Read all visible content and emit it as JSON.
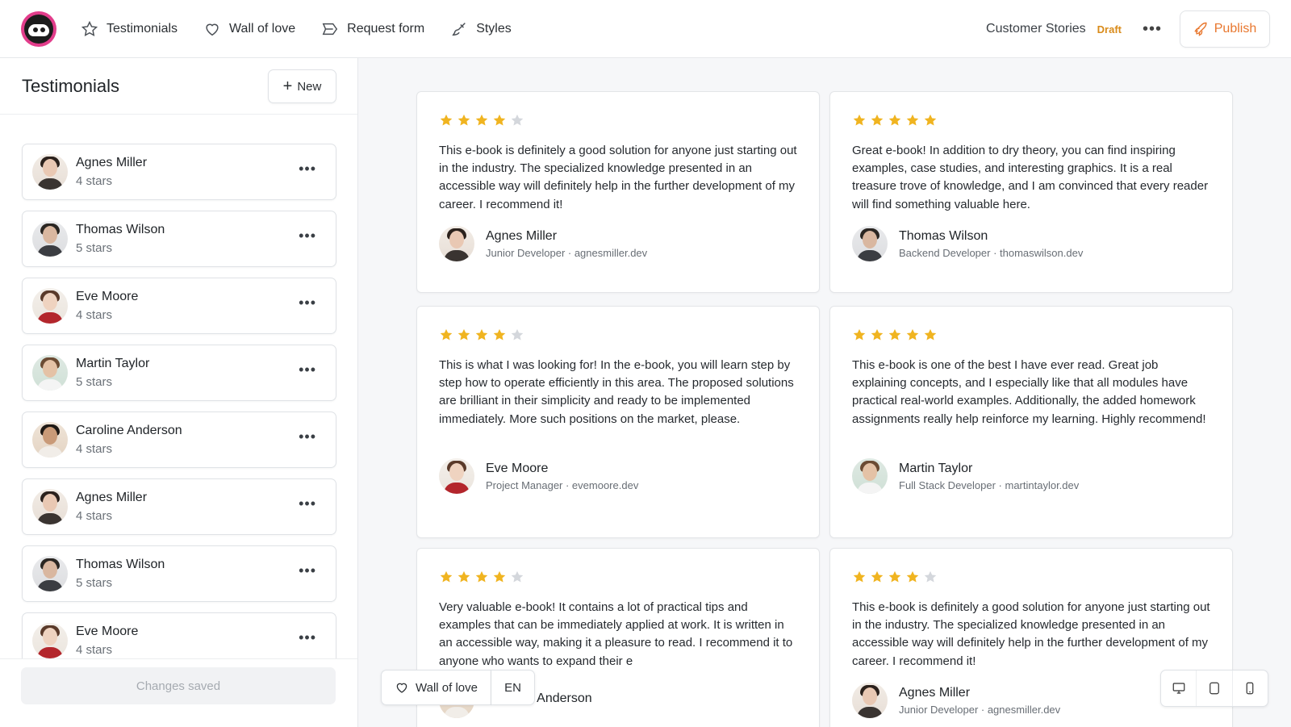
{
  "nav": {
    "items": [
      {
        "label": "Testimonials",
        "icon": "star-outline-icon"
      },
      {
        "label": "Wall of love",
        "icon": "heart-outline-icon"
      },
      {
        "label": "Request form",
        "icon": "send-icon"
      },
      {
        "label": "Styles",
        "icon": "brush-icon"
      }
    ],
    "project_name": "Customer Stories",
    "status": "Draft",
    "publish_label": "Publish",
    "colors": {
      "accent": "#e8772e",
      "draft": "#d98b1a",
      "brand": "#e23d8b"
    }
  },
  "sidebar": {
    "title": "Testimonials",
    "new_label": "New",
    "items": [
      {
        "name": "Agnes Miller",
        "rating": "4 stars"
      },
      {
        "name": "Thomas Wilson",
        "rating": "5 stars"
      },
      {
        "name": "Eve Moore",
        "rating": "4 stars"
      },
      {
        "name": "Martin Taylor",
        "rating": "5 stars"
      },
      {
        "name": "Caroline Anderson",
        "rating": "4 stars"
      },
      {
        "name": "Agnes Miller",
        "rating": "4 stars"
      },
      {
        "name": "Thomas Wilson",
        "rating": "5 stars"
      },
      {
        "name": "Eve Moore",
        "rating": "4 stars"
      }
    ],
    "footer_status": "Changes saved"
  },
  "cards": [
    {
      "stars": 4,
      "text": "This e-book is definitely a good solution for anyone just starting out in the industry. The specialized knowledge presented in an accessible way will definitely help in the further development of my career. I recommend it!",
      "name": "Agnes Miller",
      "meta": "Junior Developer · agnesmiller.dev"
    },
    {
      "stars": 5,
      "text": "Great e-book! In addition to dry theory, you can find inspiring examples, case studies, and interesting graphics. It is a real treasure trove of knowledge, and I am convinced that every reader will find something valuable here.",
      "name": "Thomas Wilson",
      "meta": "Backend Developer · thomaswilson.dev"
    },
    {
      "stars": 4,
      "text": "This is what I was looking for! In the e-book, you will learn step by step how to operate efficiently in this area. The proposed solutions are brilliant in their simplicity and ready to be implemented immediately. More such positions on the market, please.",
      "name": "Eve Moore",
      "meta": "Project Manager · evemoore.dev"
    },
    {
      "stars": 5,
      "text": "This e-book is one of the best I have ever read. Great job explaining concepts, and I especially like that all modules have practical real-world examples. Additionally, the added homework assignments really help reinforce my learning. Highly recommend!",
      "name": "Martin Taylor",
      "meta": "Full Stack Developer · martintaylor.dev"
    },
    {
      "stars": 4,
      "text": "Very valuable e-book! It contains a lot of practical tips and examples that can be immediately applied at work. It is written in an accessible way, making it a pleasure to read. I recommend it to anyone who wants to expand their e",
      "name": "Caroline Anderson",
      "meta": ""
    },
    {
      "stars": 4,
      "text": "This e-book is definitely a good solution for anyone just starting out in the industry. The specialized knowledge presented in an accessible way will definitely help in the further development of my career. I recommend it!",
      "name": "Agnes Miller",
      "meta": "Junior Developer · agnesmiller.dev"
    }
  ],
  "floating": {
    "wall_label": "Wall of love",
    "lang": "EN",
    "devices": [
      "desktop-icon",
      "tablet-icon",
      "mobile-icon"
    ]
  },
  "star_colors": {
    "filled": "#f0b420",
    "empty": "#d4d7dc"
  }
}
